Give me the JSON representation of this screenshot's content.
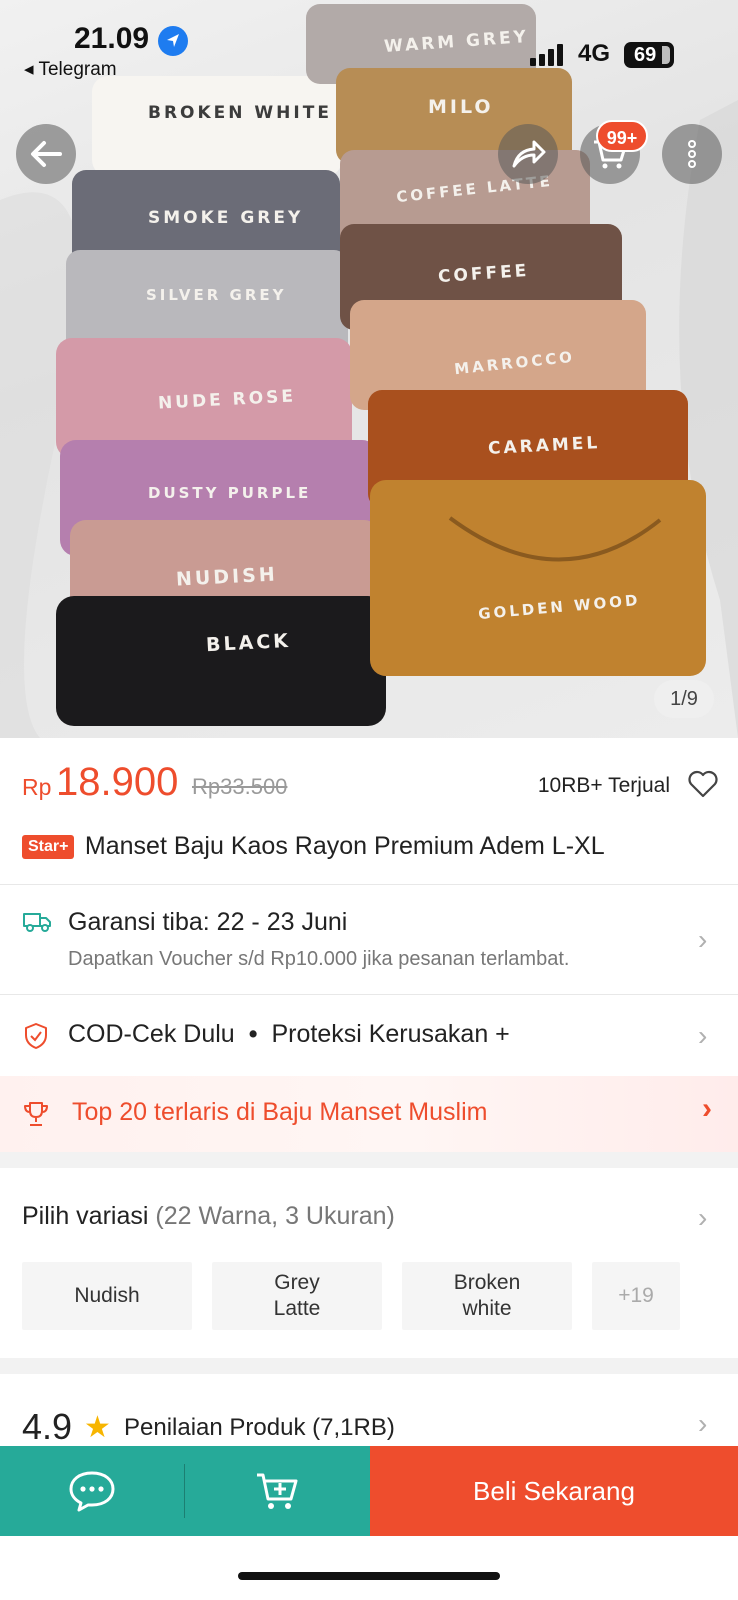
{
  "status_bar": {
    "time": "21.09",
    "back_app": "◂ Telegram",
    "network": "4G",
    "battery": "69"
  },
  "hero": {
    "cart_badge": "99+",
    "image_counter": "1/9",
    "shirt_labels": [
      "WARM GREY",
      "BROKEN WHITE",
      "MILO",
      "SMOKE GREY",
      "COFFEE LATTE",
      "SILVER GREY",
      "COFFEE",
      "NUDE ROSE",
      "MARROCCO",
      "CARAMEL",
      "DUSTY PURPLE",
      "NUDISH",
      "GOLDEN WOOD",
      "BLACK"
    ]
  },
  "product": {
    "currency": "Rp",
    "price": "18.900",
    "original_price": "Rp33.500",
    "sold": "10RB+ Terjual",
    "badge": "Star+",
    "title": "Manset Baju Kaos Rayon Premium Adem L-XL"
  },
  "shipping": {
    "title": "Garansi tiba: 22 - 23 Juni",
    "subtitle": "Dapatkan Voucher s/d Rp10.000 jika pesanan terlambat."
  },
  "services": {
    "cod": "COD-Cek Dulu",
    "separator": "•",
    "protection": "Proteksi Kerusakan +"
  },
  "ranking": {
    "text": "Top 20 terlaris di Baju Manset Muslim"
  },
  "variations": {
    "label": "Pilih variasi",
    "summary": "(22 Warna, 3 Ukuran)",
    "chips": [
      "Nudish",
      "Grey\nLatte",
      "Broken\nwhite"
    ],
    "more": "+19"
  },
  "rating": {
    "value": "4.9",
    "label": "Penilaian Produk",
    "count": "(7,1RB)"
  },
  "bottom_bar": {
    "buy_label": "Beli Sekarang"
  },
  "colors": {
    "accent": "#ee4d2d",
    "teal": "#26aa99"
  }
}
